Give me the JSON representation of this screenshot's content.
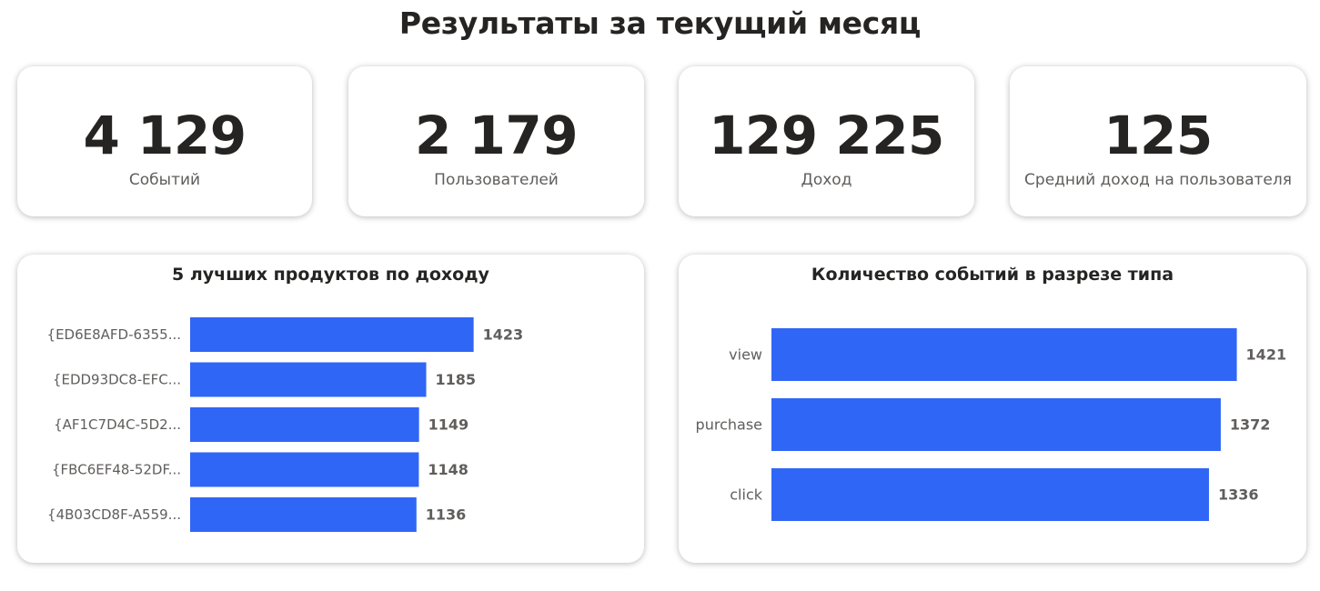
{
  "page": {
    "title": "Результаты за текущий месяц"
  },
  "kpis": [
    {
      "value": "4 129",
      "label": "Событий"
    },
    {
      "value": "2 179",
      "label": "Пользователей"
    },
    {
      "value": "129 225",
      "label": "Доход"
    },
    {
      "value": "125",
      "label": "Средний доход на пользователя"
    }
  ],
  "colors": {
    "bar": "#3066f6",
    "category_label": "#605e5c",
    "value_label": "#605e5c"
  },
  "chart_data": [
    {
      "type": "bar",
      "orientation": "horizontal",
      "title": "5 лучших продуктов по доходу",
      "xlabel": "",
      "ylabel": "",
      "categories": [
        "{ED6E8AFD-6355...",
        "{EDD93DC8-EFC...",
        "{AF1C7D4C-5D2...",
        "{FBC6EF48-52DF...",
        "{4B03CD8F-A559..."
      ],
      "values": [
        1423,
        1185,
        1149,
        1148,
        1136
      ],
      "xlim": [
        0,
        2000
      ],
      "grid": false,
      "legend": "none"
    },
    {
      "type": "bar",
      "orientation": "horizontal",
      "title": "Количество событий в разрезе типа",
      "xlabel": "",
      "ylabel": "",
      "categories": [
        "view",
        "purchase",
        "click"
      ],
      "values": [
        1421,
        1372,
        1336
      ],
      "xlim": [
        0,
        1550
      ],
      "grid": false,
      "legend": "none"
    }
  ]
}
